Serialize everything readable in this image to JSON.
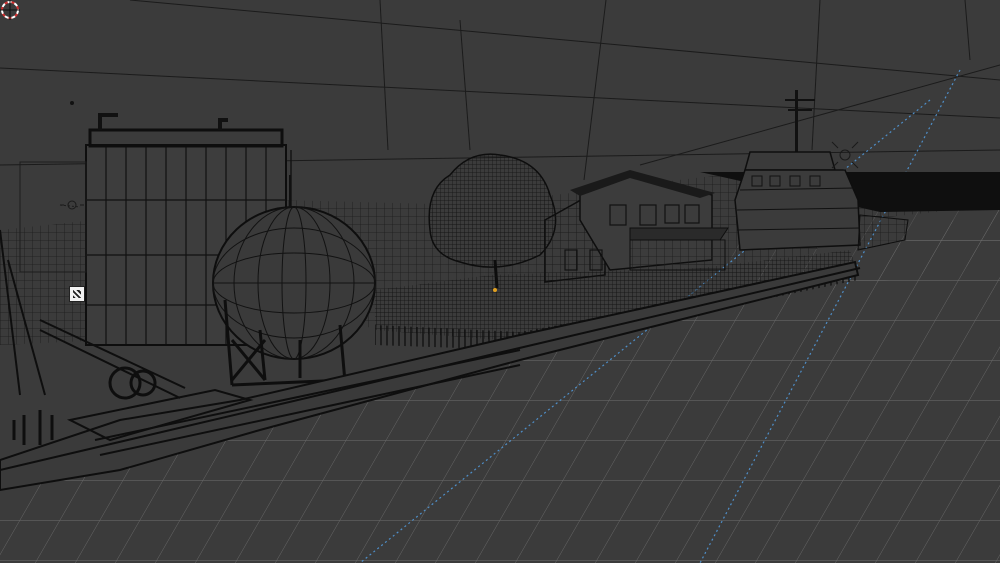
{
  "viewport": {
    "mode": "wireframe",
    "background_color": "#3b3b3b",
    "wire_color": "#141414",
    "grid_color": "#7a7a7a",
    "axis_y_color": "#4f8fc9"
  },
  "scene_objects": [
    {
      "name": "cylindrical-storage-tank",
      "icon": "tank-icon"
    },
    {
      "name": "spherical-gas-tank",
      "icon": "sphere-icon"
    },
    {
      "name": "tree",
      "icon": "tree-icon"
    },
    {
      "name": "house",
      "icon": "house-icon"
    },
    {
      "name": "tugboat",
      "icon": "boat-icon"
    },
    {
      "name": "barge",
      "icon": "barge-icon"
    },
    {
      "name": "terrain-plane",
      "icon": "plane-icon"
    }
  ],
  "overlays": {
    "cursor": "3d-cursor-icon",
    "empty": "image-empty-icon",
    "light": "light-icon"
  }
}
